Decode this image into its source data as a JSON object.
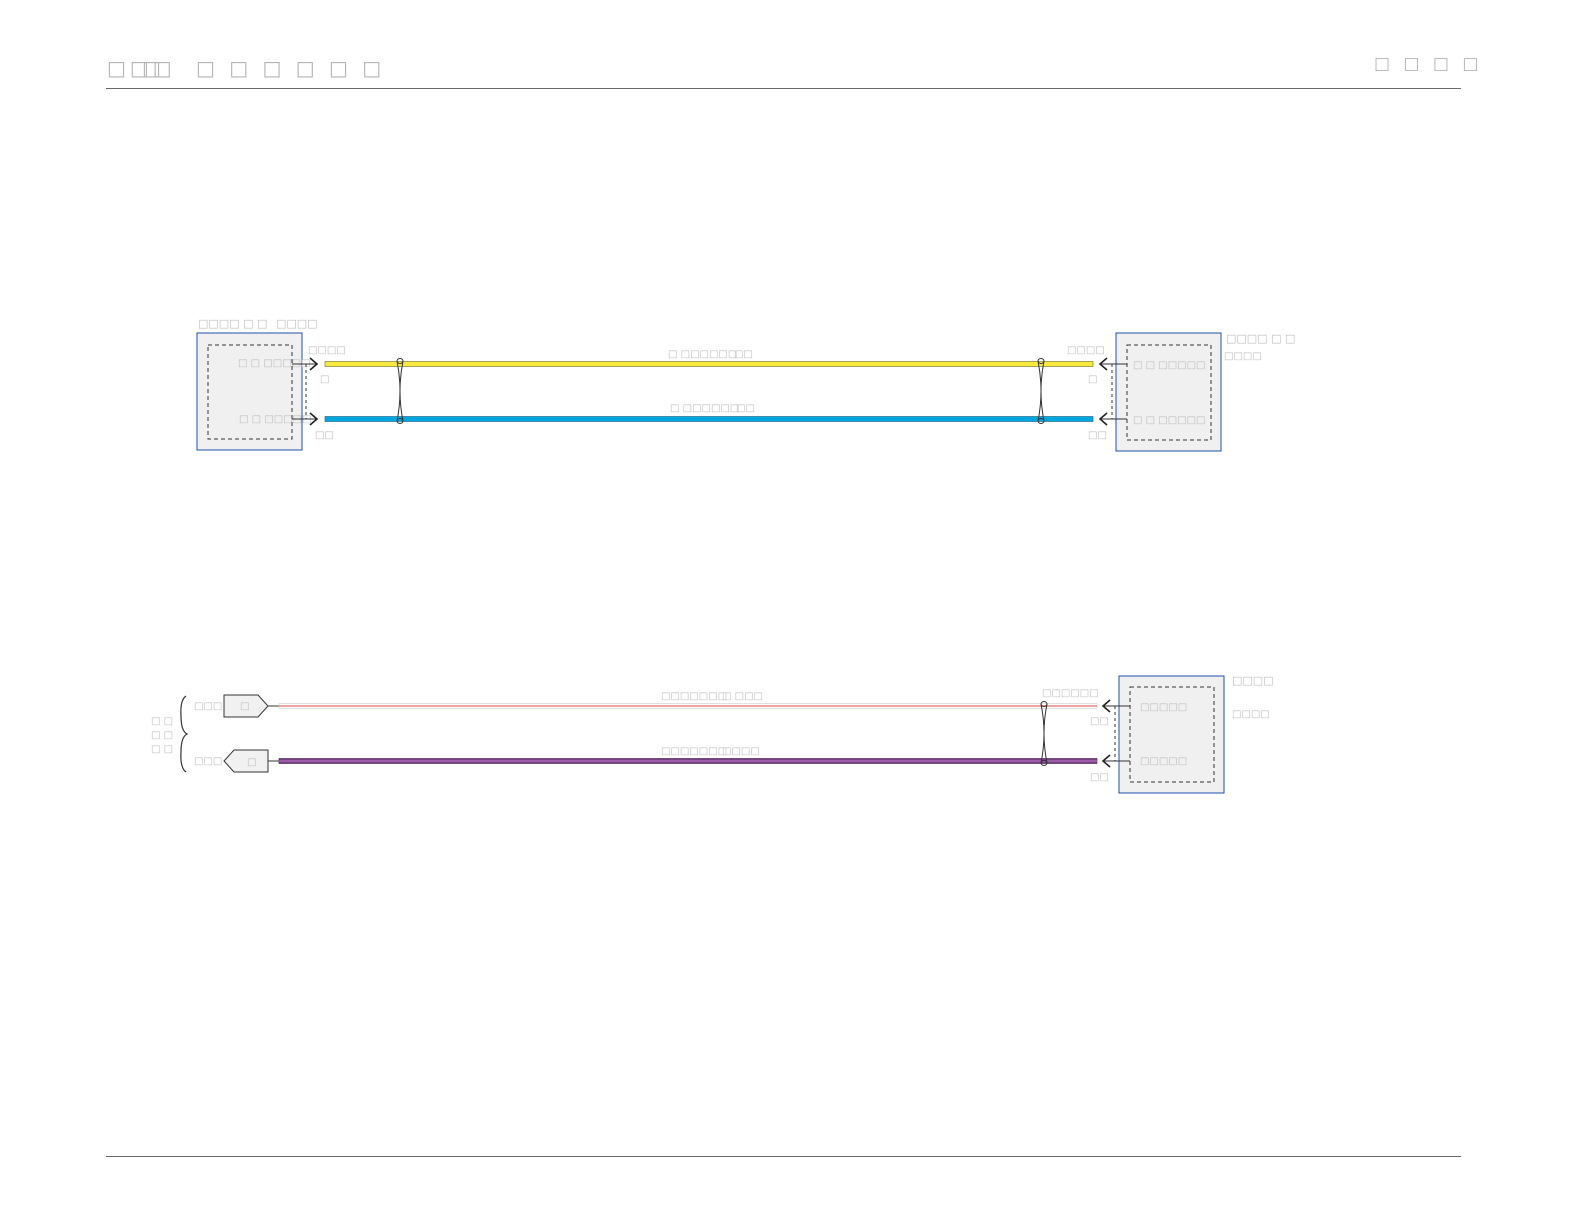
{
  "header": {
    "section": "□□□",
    "section_suffix": "□",
    "title": "□ □ □ □ □ □",
    "page_ref": "□ □ □ □"
  },
  "diagram1": {
    "left_module": {
      "title": "□□□□ □ □",
      "code": "□□□□",
      "pin_top": "□ □ □□□□□",
      "pin_bottom": "□ □ □□□□□"
    },
    "left_conn_top": "□□□□",
    "left_pin_num_top": "□",
    "left_pin_num_bottom": "□□",
    "right_module": {
      "title": "□□□□ □ □",
      "code": "□□□□",
      "pin_top": "□ □ □□□□□",
      "pin_bottom": "□ □ □□□□□"
    },
    "right_conn_top": "□□□□",
    "right_pin_num_top": "□",
    "right_pin_num_bottom": "□□",
    "wire_top": {
      "label": "□ □□□□□□",
      "spec": "□□",
      "color": "#f7ea3d"
    },
    "wire_bottom": {
      "label": "□ □□□□□□",
      "spec": "□□",
      "color": "#00a6e0"
    }
  },
  "diagram2": {
    "bracket_label": [
      "□ □",
      "□ □",
      "□ □"
    ],
    "ref_top": {
      "label": "□□□",
      "glyph": "□"
    },
    "ref_bottom": {
      "label": "□□□",
      "glyph": "□"
    },
    "wire_top": {
      "label": "□□□□□□□",
      "spec": "□ □□□",
      "color": "#e88a83"
    },
    "wire_bottom": {
      "label": "□□□□□□□",
      "spec": "□□□□",
      "color": "#7a3f86"
    },
    "right_conn_top": "□□□□□□",
    "right_pin_num_top": "□□",
    "right_pin_num_bottom": "□□",
    "right_module": {
      "title": "□□□□",
      "code": "□□□□",
      "pin_top": "□□□□□",
      "pin_bottom": "□□□□□"
    }
  }
}
